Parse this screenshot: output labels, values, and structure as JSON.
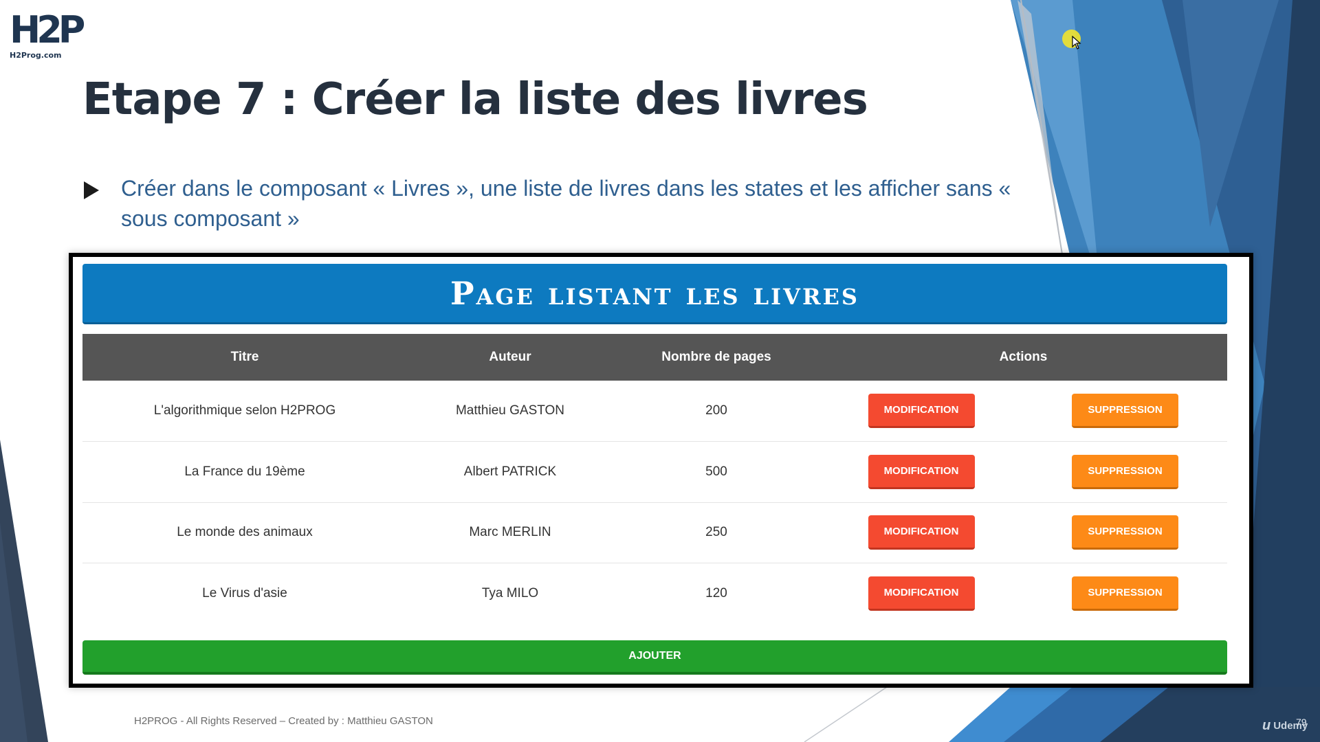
{
  "slide": {
    "title": "Etape 7 : Créer la liste des livres",
    "bullet_text": "Créer dans le composant « Livres », une liste de livres dans les states et les afficher sans « sous composant »"
  },
  "logo": {
    "text": "H2P",
    "site": "H2Prog.com"
  },
  "app": {
    "banner_title": "Page listant les livres",
    "columns": [
      "Titre",
      "Auteur",
      "Nombre de pages",
      "Actions"
    ],
    "rows": [
      {
        "titre": "L'algorithmique selon H2PROG",
        "auteur": "Matthieu GASTON",
        "pages": "200"
      },
      {
        "titre": "La France du 19ème",
        "auteur": "Albert PATRICK",
        "pages": "500"
      },
      {
        "titre": "Le monde des animaux",
        "auteur": "Marc MERLIN",
        "pages": "250"
      },
      {
        "titre": "Le Virus d'asie",
        "auteur": "Tya MILO",
        "pages": "120"
      }
    ],
    "modify_label": "Modification",
    "delete_label": "Suppression",
    "add_label": "Ajouter"
  },
  "footer": {
    "credits": "H2PROG - All Rights Reserved – Created by : Matthieu GASTON",
    "page_number": "79",
    "watermark": "Udemy"
  },
  "colors": {
    "banner": "#0d7ac0",
    "table_header": "#555555",
    "modify_button": "#f44a30",
    "delete_button": "#fd8a17",
    "add_button": "#22a02c",
    "title_text": "#25303e",
    "bullet_text": "#2f5f8f"
  },
  "icons": {
    "bullet": "triangle-bullet-icon",
    "cursor": "mouse-pointer-icon",
    "udemy": "udemy-logo-icon"
  }
}
